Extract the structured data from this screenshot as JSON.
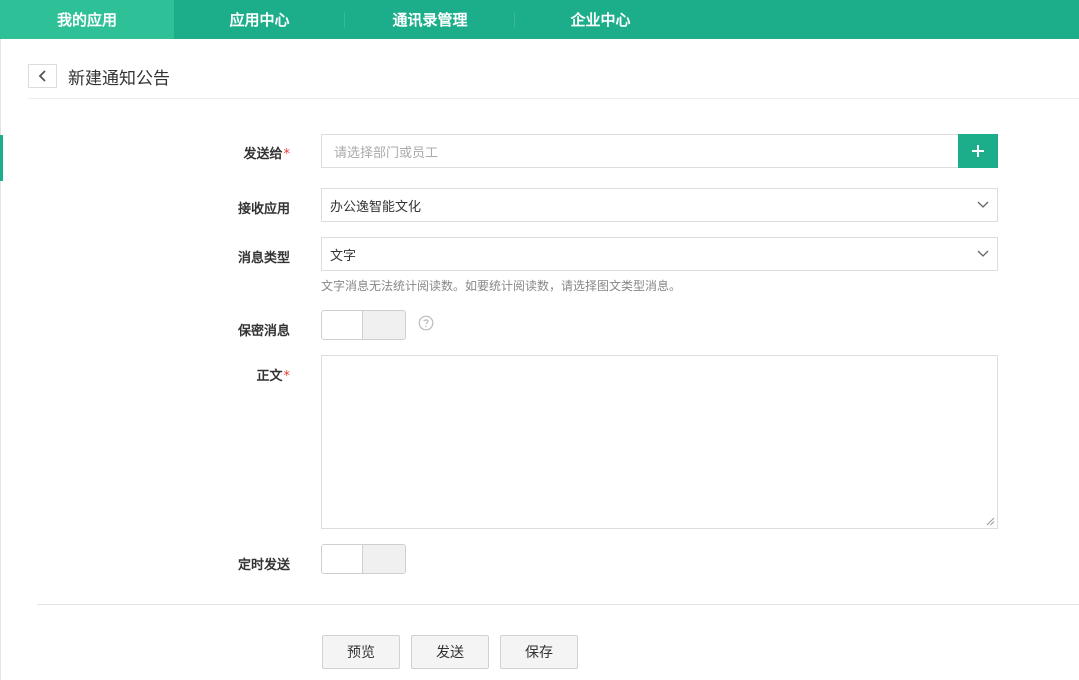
{
  "topnav": {
    "items": [
      {
        "label": "我的应用",
        "active": true
      },
      {
        "label": "应用中心",
        "active": false
      },
      {
        "label": "通讯录管理",
        "active": false
      },
      {
        "label": "企业中心",
        "active": false
      }
    ]
  },
  "page": {
    "title": "新建通知公告"
  },
  "form": {
    "send_to": {
      "label": "发送给",
      "required_mark": "*",
      "placeholder": "请选择部门或员工",
      "add_icon": "plus-icon"
    },
    "receive_app": {
      "label": "接收应用",
      "value": "办公逸智能文化"
    },
    "message_type": {
      "label": "消息类型",
      "value": "文字",
      "hint": "文字消息无法统计阅读数。如要统计阅读数，请选择图文类型消息。"
    },
    "confidential": {
      "label": "保密消息",
      "on": false,
      "help_icon": "question-circle-icon"
    },
    "body": {
      "label": "正文",
      "required_mark": "*",
      "value": ""
    },
    "scheduled": {
      "label": "定时发送",
      "on": false
    }
  },
  "actions": {
    "preview_label": "预览",
    "send_label": "发送",
    "save_label": "保存"
  },
  "colors": {
    "brand": "#1cae8a",
    "nav_active": "#2ec197",
    "required": "#e53935"
  }
}
